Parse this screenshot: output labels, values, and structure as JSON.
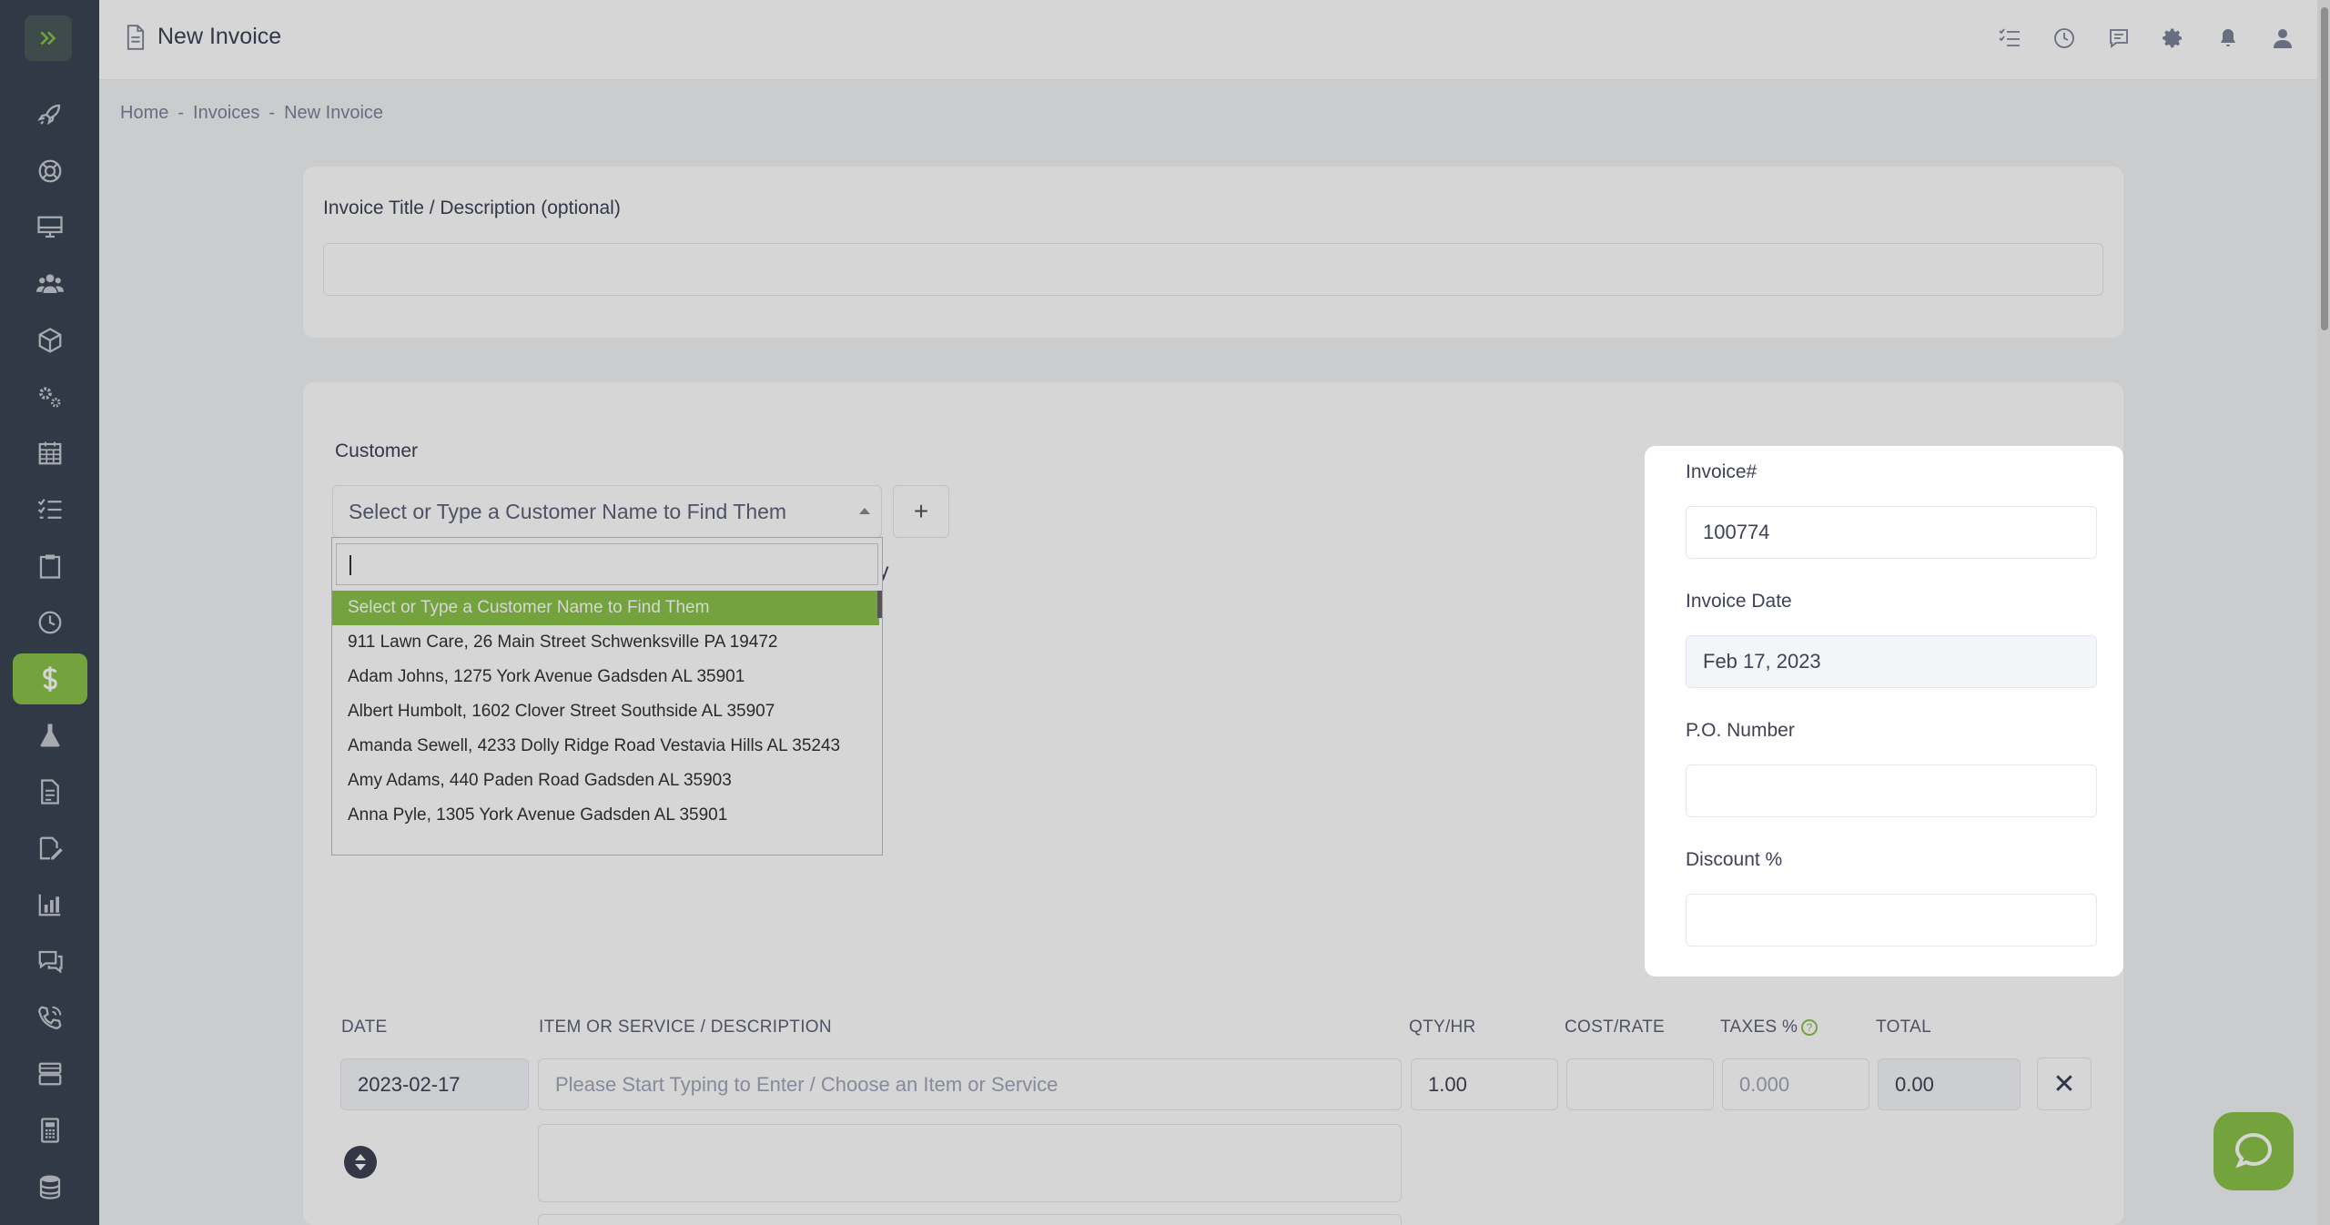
{
  "header": {
    "title": "New Invoice",
    "icons": [
      "tasks-icon",
      "clock-icon",
      "chat-icon",
      "gear-icon",
      "bell-icon",
      "user-icon"
    ]
  },
  "breadcrumb": {
    "home": "Home",
    "sep": "-",
    "invoices": "Invoices",
    "current": "New Invoice"
  },
  "sidebar": {
    "items": [
      {
        "name": "rocket-icon"
      },
      {
        "name": "lifebuoy-icon"
      },
      {
        "name": "monitor-icon"
      },
      {
        "name": "users-icon"
      },
      {
        "name": "box-icon"
      },
      {
        "name": "gears-icon"
      },
      {
        "name": "calendar-icon"
      },
      {
        "name": "checklist-icon"
      },
      {
        "name": "clipboard-icon"
      },
      {
        "name": "clock-icon"
      },
      {
        "name": "dollar-icon",
        "active": true
      },
      {
        "name": "flask-icon"
      },
      {
        "name": "document-icon"
      },
      {
        "name": "signature-icon"
      },
      {
        "name": "bar-chart-icon"
      },
      {
        "name": "chat-icon"
      },
      {
        "name": "phone-icon"
      },
      {
        "name": "server-icon"
      },
      {
        "name": "calculator-icon"
      },
      {
        "name": "database-icon"
      }
    ],
    "accent": "#8bc34a"
  },
  "title_card": {
    "label": "Invoice Title / Description (optional)",
    "value": ""
  },
  "customer": {
    "label": "Customer",
    "placeholder": "Select or Type a Customer Name to Find Them",
    "add_label": "+",
    "partial_text": "y",
    "search_value": "",
    "options": [
      "Select or Type a Customer Name to Find Them",
      "911 Lawn Care, 26 Main Street Schwenksville PA 19472",
      "Adam Johns, 1275 York Avenue Gadsden AL 35901",
      "Albert Humbolt, 1602 Clover Street Southside AL 35907",
      "Amanda Sewell, 4233 Dolly Ridge Road Vestavia Hills AL 35243",
      "Amy Adams, 440 Paden Road Gadsden AL 35903",
      "Anna Pyle, 1305 York Avenue Gadsden AL 35901"
    ]
  },
  "invoice_panel": {
    "number_label": "Invoice#",
    "number_value": "100774",
    "date_label": "Invoice Date",
    "date_value": "Feb 17, 2023",
    "po_label": "P.O. Number",
    "po_value": "",
    "discount_label": "Discount %",
    "discount_value": ""
  },
  "line_items": {
    "headers": {
      "date": "DATE",
      "item": "ITEM OR SERVICE / DESCRIPTION",
      "qty": "QTY/HR",
      "cost": "COST/RATE",
      "taxes": "TAXES %",
      "total": "TOTAL"
    },
    "help_glyph": "?",
    "row": {
      "date": "2023-02-17",
      "item_placeholder": "Please Start Typing to Enter / Choose an Item or Service",
      "qty": "1.00",
      "cost": "",
      "taxes_placeholder": "0.000",
      "total": "0.00",
      "remove_label": "✕"
    }
  }
}
